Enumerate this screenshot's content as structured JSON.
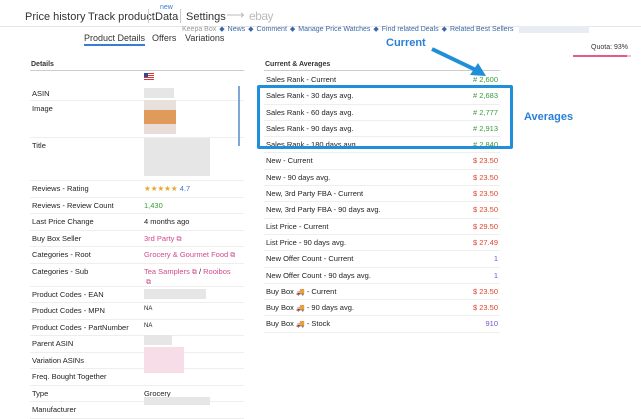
{
  "nav": {
    "tabs": [
      "Price history",
      "Track product",
      "Data",
      "Settings"
    ],
    "new_badge": "new",
    "target": "ebay"
  },
  "sublinks": {
    "items": [
      "Keepa Box",
      "News",
      "Comment",
      "Manage Price Watches",
      "Find related Deals",
      "Related Best Sellers"
    ]
  },
  "subtabs": [
    "Product Details",
    "Offers",
    "Variations"
  ],
  "quota": "Quota: 93%",
  "quota_fraction": 0.93,
  "details": {
    "heading": "Details",
    "rows": [
      {
        "label": "ASIN",
        "value": ""
      },
      {
        "label": "Image",
        "value": ""
      },
      {
        "label": "Title",
        "value": ""
      },
      {
        "label": "Reviews - Rating",
        "value": "4.7"
      },
      {
        "label": "Reviews - Review Count",
        "value": "1,430"
      },
      {
        "label": "Last Price Change",
        "value": "4 months ago"
      },
      {
        "label": "Buy Box Seller",
        "value": "3rd Party"
      },
      {
        "label": "Categories - Root",
        "value": "Grocery & Gourmet Food"
      },
      {
        "label": "Categories - Sub",
        "value": "Tea Samplers",
        "value2": "Rooibos"
      },
      {
        "label": "Product Codes - EAN",
        "value": ""
      },
      {
        "label": "Product Codes - MPN",
        "value": "NA"
      },
      {
        "label": "Product Codes - PartNumber",
        "value": "NA"
      },
      {
        "label": "Parent ASIN",
        "value": ""
      },
      {
        "label": "Variation ASINs",
        "value": ""
      },
      {
        "label": "Freq. Bought Together",
        "value": ""
      },
      {
        "label": "Type",
        "value": "Grocery"
      },
      {
        "label": "Manufacturer",
        "value": ""
      }
    ],
    "rating_stars": 4.7
  },
  "ranks": {
    "heading": "Current & Averages",
    "rows": [
      {
        "label": "Sales Rank - Current",
        "value": "# 2,600",
        "color": "green"
      },
      {
        "label": "Sales Rank - 30 days avg.",
        "value": "# 2,683",
        "color": "green"
      },
      {
        "label": "Sales Rank - 60 days avg.",
        "value": "# 2,777",
        "color": "green"
      },
      {
        "label": "Sales Rank - 90 days avg.",
        "value": "# 2,913",
        "color": "green"
      },
      {
        "label": "Sales Rank - 180 days avg.",
        "value": "# 2,840",
        "color": "green"
      },
      {
        "label": "New - Current",
        "value": "$ 23.50",
        "color": "red"
      },
      {
        "label": "New - 90 days avg.",
        "value": "$ 23.50",
        "color": "red"
      },
      {
        "label": "New, 3rd Party FBA - Current",
        "value": "$ 23.50",
        "color": "red"
      },
      {
        "label": "New, 3rd Party FBA - 90 days avg.",
        "value": "$ 23.50",
        "color": "red"
      },
      {
        "label": "List Price - Current",
        "value": "$ 29.50",
        "color": "red"
      },
      {
        "label": "List Price - 90 days avg.",
        "value": "$ 27.49",
        "color": "red"
      },
      {
        "label": "New Offer Count - Current",
        "value": "1",
        "color": "purple"
      },
      {
        "label": "New Offer Count - 90 days avg.",
        "value": "1",
        "color": "purple"
      },
      {
        "label": "Buy Box",
        "suffix": "- Current",
        "value": "$ 23.50",
        "color": "red",
        "truck": true
      },
      {
        "label": "Buy Box",
        "suffix": "- 90 days avg.",
        "value": "$ 23.50",
        "color": "red",
        "truck": true
      },
      {
        "label": "Buy Box",
        "suffix": "- Stock",
        "value": "910",
        "color": "purple",
        "truck": true
      }
    ]
  },
  "callouts": {
    "current": "Current",
    "averages": "Averages"
  },
  "colors": {
    "accent": "#3a7bd5",
    "highlight": "#1e8fd8",
    "green": "#3a9a3a",
    "red": "#d9462f",
    "purple": "#7a4fd0",
    "link": "#d04a8c"
  }
}
